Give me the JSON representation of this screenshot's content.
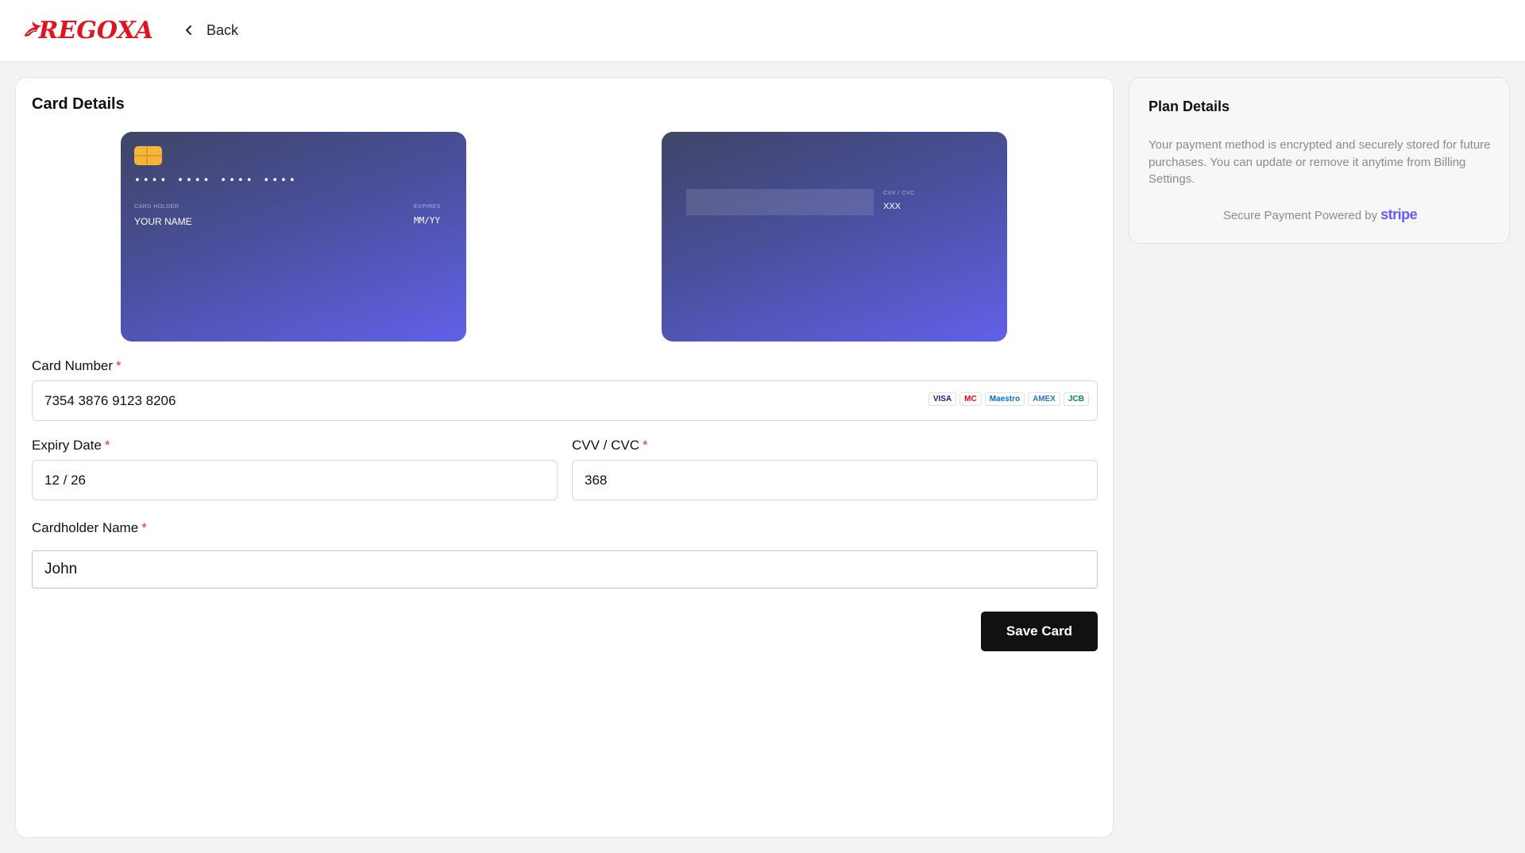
{
  "header": {
    "logo_text": "REGOXA",
    "back_label": "Back"
  },
  "card_section": {
    "title": "Card Details",
    "front": {
      "number_mask": "•••• •••• •••• ••••",
      "holder_label": "CARD HOLDER",
      "holder_value": "YOUR NAME",
      "expires_label": "EXPIRES",
      "expires_value": "MM/YY"
    },
    "back": {
      "cvv_label": "CVV / CVC",
      "cvv_value": "XXX"
    }
  },
  "form": {
    "card_number": {
      "label": "Card Number",
      "required_mark": "*",
      "value": "7354 3876 9123 8206"
    },
    "brands": [
      {
        "name": "VISA",
        "color": "#1a1f71"
      },
      {
        "name": "MC",
        "color": "#eb001b"
      },
      {
        "name": "Maestro",
        "color": "#0070c9"
      },
      {
        "name": "AMEX",
        "color": "#2e77bb"
      },
      {
        "name": "JCB",
        "color": "#0b8a3e"
      }
    ],
    "expiry": {
      "label": "Expiry Date",
      "required_mark": "*",
      "value": "12 / 26"
    },
    "cvv": {
      "label": "CVV / CVC",
      "required_mark": "*",
      "value": "368"
    },
    "cardholder": {
      "label": "Cardholder Name",
      "required_mark": "*",
      "value": "John"
    },
    "save_label": "Save Card"
  },
  "plan": {
    "title": "Plan Details",
    "description": "Your payment method is encrypted and securely stored for future purchases. You can update or remove it anytime from Billing Settings.",
    "powered_text": "Secure Payment Powered by",
    "provider": "stripe"
  },
  "colors": {
    "accent": "#111111",
    "brand_red": "#e0141e",
    "stripe": "#635bff",
    "required": "#e0343a"
  }
}
